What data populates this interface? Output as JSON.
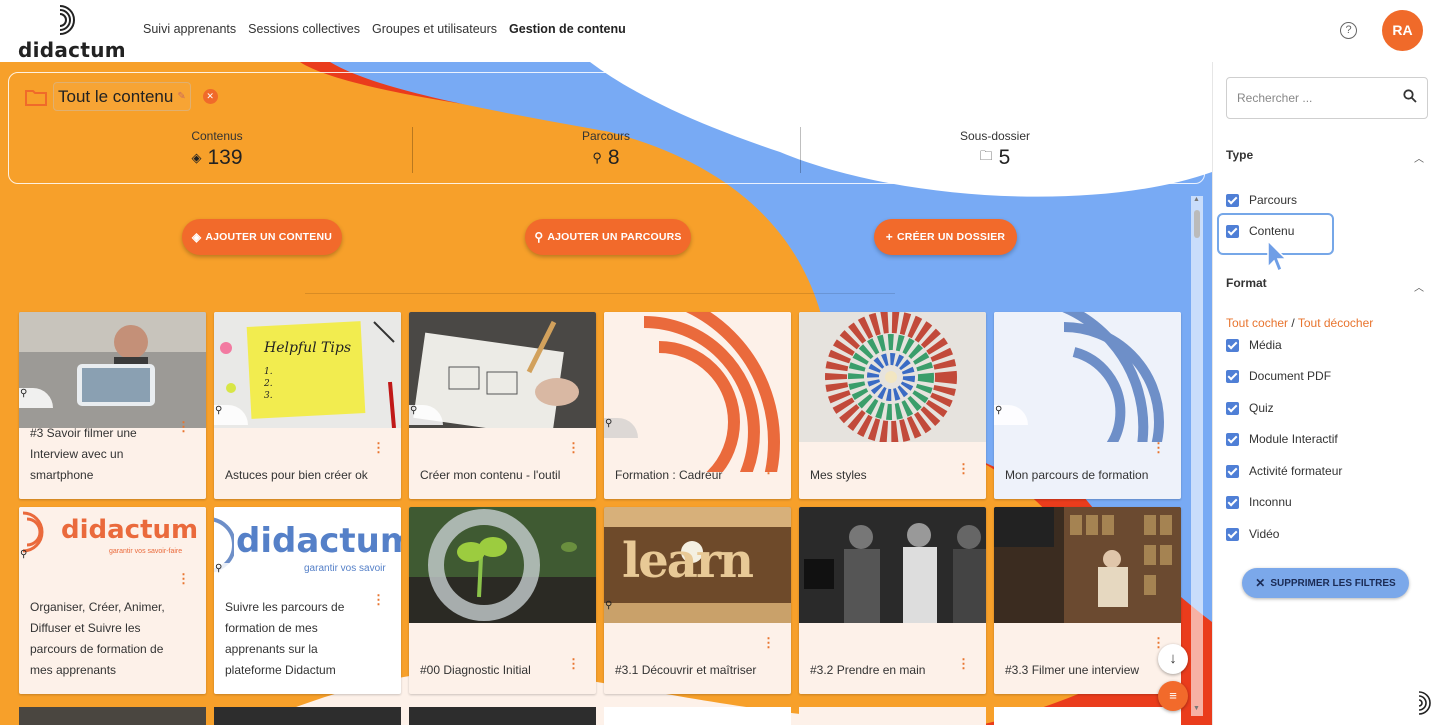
{
  "header": {
    "logo_text": "didactum",
    "nav": [
      "Suivi apprenants",
      "Sessions collectives",
      "Groupes et utilisateurs",
      "Gestion de contenu"
    ],
    "active_nav": "Gestion de contenu",
    "avatar_initials": "RA",
    "help_icon": "question-circle-icon"
  },
  "summary": {
    "folder_title": "Tout le contenu",
    "stats": [
      {
        "label": "Contenus",
        "value": "139",
        "icon": "content-stack-icon"
      },
      {
        "label": "Parcours",
        "value": "8",
        "icon": "route-icon"
      },
      {
        "label": "Sous-dossier",
        "value": "5",
        "icon": "folder-icon"
      }
    ]
  },
  "actions": {
    "add_content": "AJOUTER UN CONTENU",
    "add_route": "AJOUTER UN PARCOURS",
    "create_folder": "CRÉER UN DOSSIER"
  },
  "cards": [
    {
      "title": "#3 Savoir filmer une Interview avec un smartphone"
    },
    {
      "title": "Astuces pour bien créer ok",
      "thumb_text": "Helpful Tips"
    },
    {
      "title": "Créer mon contenu - l'outil"
    },
    {
      "title": "Formation : Cadreur"
    },
    {
      "title": "Mes styles"
    },
    {
      "title": "Mon parcours de formation"
    },
    {
      "title": "Organiser, Créer, Animer, Diffuser et Suivre les parcours de formation de mes apprenants",
      "thumb_text": "didactum",
      "thumb_sub": "garantir vos savoir-faire"
    },
    {
      "title": "Suivre les parcours de formation de mes apprenants sur la plateforme Didactum",
      "thumb_text": "didactum",
      "thumb_sub": "garantir vos savoir"
    },
    {
      "title": "#00 Diagnostic Initial"
    },
    {
      "title": "#3.1 Découvrir et maîtriser",
      "thumb_text": "learn"
    },
    {
      "title": "#3.2 Prendre en main"
    },
    {
      "title": "#3.3 Filmer une interview"
    }
  ],
  "filters": {
    "search_placeholder": "Rechercher ...",
    "type_title": "Type",
    "types": [
      "Parcours",
      "Contenu"
    ],
    "format_title": "Format",
    "check_all": "Tout cocher",
    "separator": "/",
    "uncheck_all": "Tout décocher",
    "formats": [
      "Média",
      "Document PDF",
      "Quiz",
      "Module Interactif",
      "Activité formateur",
      "Inconnu",
      "Vidéo"
    ],
    "clear_filters": "SUPPRIMER LES FILTRES"
  },
  "colors": {
    "accent": "#f26a2b",
    "orange_bg": "#f7a02a",
    "red_bg": "#ea3c1c",
    "blue_bg": "#78aaf4",
    "checkbox": "#4f7fd6"
  }
}
